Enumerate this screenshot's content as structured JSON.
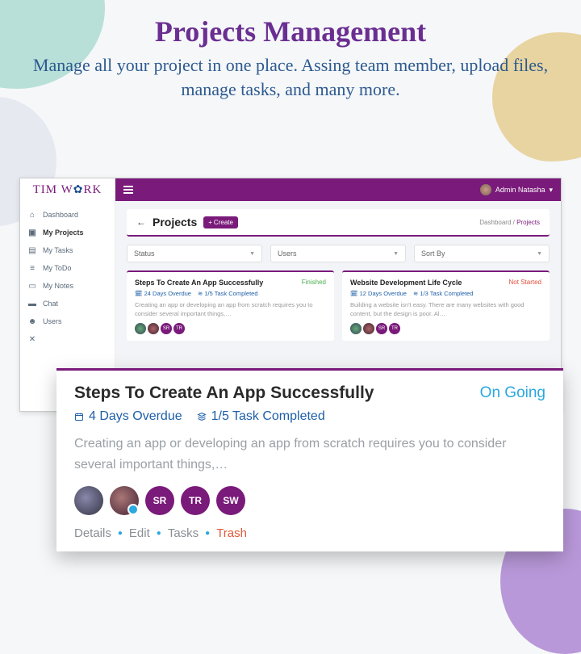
{
  "hero": {
    "title": "Projects Management",
    "subtitle": "Manage all your project in one place. Assing team member, upload files, manage tasks, and many more."
  },
  "brand": {
    "pre": "TIM W",
    "post": "RK"
  },
  "user": {
    "name": "Admin Natasha"
  },
  "sidebar": {
    "items": [
      {
        "icon": "home",
        "label": "Dashboard"
      },
      {
        "icon": "briefcase",
        "label": "My Projects"
      },
      {
        "icon": "check",
        "label": "My Tasks"
      },
      {
        "icon": "list",
        "label": "My ToDo"
      },
      {
        "icon": "note",
        "label": "My Notes"
      },
      {
        "icon": "chat",
        "label": "Chat"
      },
      {
        "icon": "users",
        "label": "Users"
      },
      {
        "icon": "cross",
        "label": ""
      }
    ]
  },
  "page": {
    "title": "Projects",
    "create_label": "Create",
    "breadcrumb_root": "Dashboard",
    "breadcrumb_current": "Projects"
  },
  "filters": {
    "status": "Status",
    "users": "Users",
    "sort": "Sort By"
  },
  "cards": [
    {
      "title": "Steps To Create An App Successfully",
      "status": "Finished",
      "status_class": "finished",
      "overdue": "24 Days Overdue",
      "tasks": "1/5 Task Completed",
      "desc": "Creating an app or developing an app from scratch requires you to consider several important things,…",
      "avatars": [
        "img1",
        "img2",
        "SR",
        "TR"
      ]
    },
    {
      "title": "Website Development Life Cycle",
      "status": "Not Started",
      "status_class": "notstarted",
      "overdue": "12 Days Overdue",
      "tasks": "1/3 Task Completed",
      "desc": "Building a website isn't easy. There are many websites with good content, but the design is poor. Al…",
      "avatars": [
        "img1",
        "img2",
        "SR",
        "TR"
      ]
    }
  ],
  "detail": {
    "title": "Steps To Create An App Successfully",
    "status": "On Going",
    "overdue": "4 Days Overdue",
    "tasks": "1/5 Task Completed",
    "desc": "Creating an app or developing an app from scratch requires you to consider several important things,…",
    "avatars": [
      "img1",
      "img2",
      "SR",
      "TR",
      "SW"
    ],
    "actions": {
      "details": "Details",
      "edit": "Edit",
      "tasks": "Tasks",
      "trash": "Trash"
    }
  }
}
